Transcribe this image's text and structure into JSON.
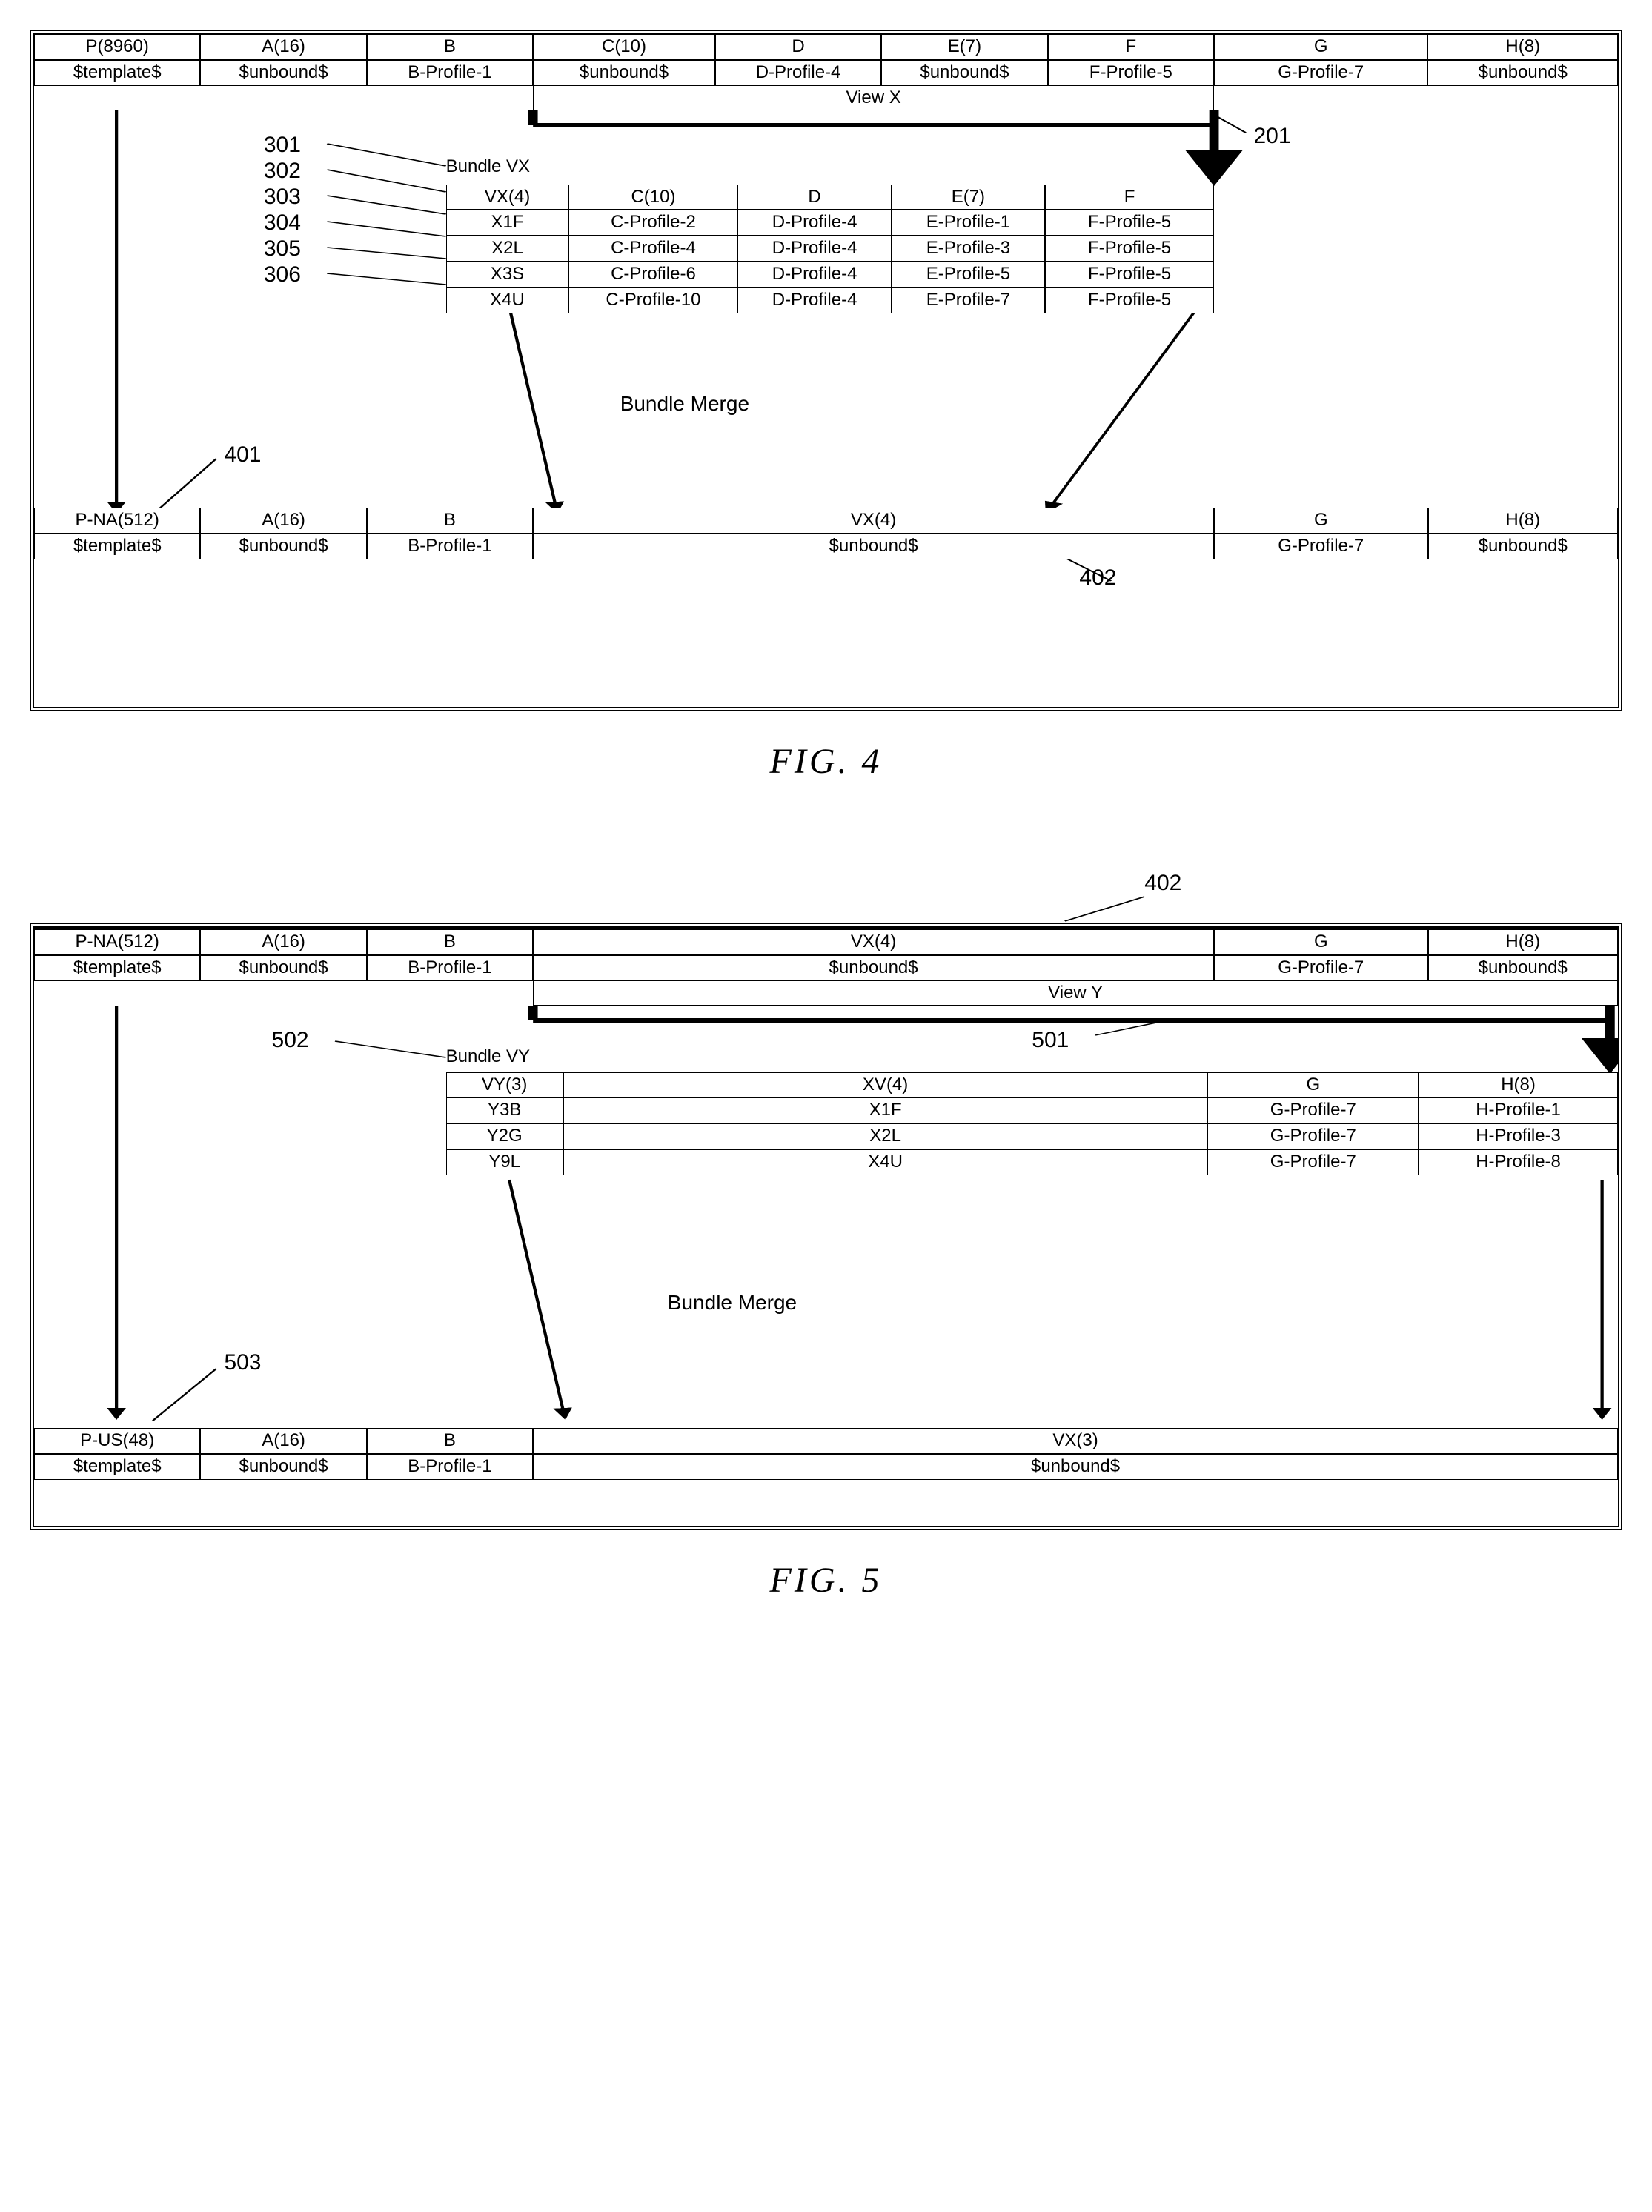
{
  "fig4": {
    "caption": "FIG.  4",
    "topHeader": [
      "P(8960)",
      "A(16)",
      "B",
      "C(10)",
      "D",
      "E(7)",
      "F",
      "G",
      "H(8)"
    ],
    "topValues": [
      "$template$",
      "$unbound$",
      "B-Profile-1",
      "$unbound$",
      "D-Profile-4",
      "$unbound$",
      "F-Profile-5",
      "G-Profile-7",
      "$unbound$"
    ],
    "viewLabel": "View X",
    "bundleLabel": "Bundle VX",
    "bundleHeader": [
      "VX(4)",
      "C(10)",
      "D",
      "E(7)",
      "F"
    ],
    "bundleRows": [
      [
        "X1F",
        "C-Profile-2",
        "D-Profile-4",
        "E-Profile-1",
        "F-Profile-5"
      ],
      [
        "X2L",
        "C-Profile-4",
        "D-Profile-4",
        "E-Profile-3",
        "F-Profile-5"
      ],
      [
        "X3S",
        "C-Profile-6",
        "D-Profile-4",
        "E-Profile-5",
        "F-Profile-5"
      ],
      [
        "X4U",
        "C-Profile-10",
        "D-Profile-4",
        "E-Profile-7",
        "F-Profile-5"
      ]
    ],
    "mergeLabel": "Bundle Merge",
    "bottomHeader": [
      "P-NA(512)",
      "A(16)",
      "B",
      "VX(4)",
      "G",
      "H(8)"
    ],
    "bottomValues": [
      "$template$",
      "$unbound$",
      "B-Profile-1",
      "$unbound$",
      "G-Profile-7",
      "$unbound$"
    ],
    "refs": {
      "r201": "201",
      "r301": "301",
      "r302": "302",
      "r303": "303",
      "r304": "304",
      "r305": "305",
      "r306": "306",
      "r401": "401",
      "r402": "402"
    }
  },
  "fig5": {
    "caption": "FIG.  5",
    "topHeader": [
      "P-NA(512)",
      "A(16)",
      "B",
      "VX(4)",
      "G",
      "H(8)"
    ],
    "topValues": [
      "$template$",
      "$unbound$",
      "B-Profile-1",
      "$unbound$",
      "G-Profile-7",
      "$unbound$"
    ],
    "viewLabel": "View Y",
    "bundleLabel": "Bundle VY",
    "bundleHeader": [
      "VY(3)",
      "XV(4)",
      "G",
      "H(8)"
    ],
    "bundleRows": [
      [
        "Y3B",
        "X1F",
        "G-Profile-7",
        "H-Profile-1"
      ],
      [
        "Y2G",
        "X2L",
        "G-Profile-7",
        "H-Profile-3"
      ],
      [
        "Y9L",
        "X4U",
        "G-Profile-7",
        "H-Profile-8"
      ]
    ],
    "mergeLabel": "Bundle Merge",
    "bottomHeader": [
      "P-US(48)",
      "A(16)",
      "B",
      "VX(3)"
    ],
    "bottomValues": [
      "$template$",
      "$unbound$",
      "B-Profile-1",
      "$unbound$"
    ],
    "refs": {
      "r402": "402",
      "r501": "501",
      "r502": "502",
      "r503": "503"
    }
  }
}
